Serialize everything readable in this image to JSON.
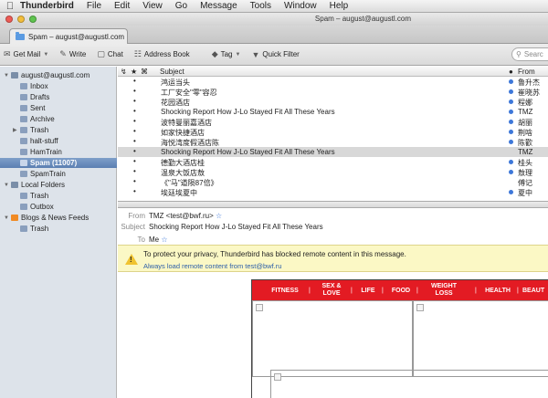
{
  "menubar": {
    "app": "Thunderbird",
    "items": [
      "File",
      "Edit",
      "View",
      "Go",
      "Message",
      "Tools",
      "Window",
      "Help"
    ]
  },
  "window": {
    "title": "Spam – august@augustl.com"
  },
  "tab": {
    "label": "Spam – august@augustl.com"
  },
  "toolbar": {
    "get_mail": "Get Mail",
    "write": "Write",
    "chat": "Chat",
    "address_book": "Address Book",
    "tag": "Tag",
    "quick_filter": "Quick Filter",
    "search_placeholder": "Searc"
  },
  "folders": [
    {
      "label": "august@augustl.com",
      "level": 0,
      "twisty": "▼",
      "icon": "account-icon",
      "color": "#7a8ea8"
    },
    {
      "label": "Inbox",
      "level": 1,
      "icon": "inbox-icon",
      "color": "#8a9fbd"
    },
    {
      "label": "Drafts",
      "level": 1,
      "icon": "drafts-icon",
      "color": "#8a9fbd"
    },
    {
      "label": "Sent",
      "level": 1,
      "icon": "sent-icon",
      "color": "#8a9fbd"
    },
    {
      "label": "Archive",
      "level": 1,
      "icon": "archive-icon",
      "color": "#8a9fbd"
    },
    {
      "label": "Trash",
      "level": 1,
      "twisty": "▶",
      "icon": "trash-icon",
      "color": "#8a9fbd"
    },
    {
      "label": "halt-stuff",
      "level": 1,
      "icon": "folder-icon",
      "color": "#8a9fbd"
    },
    {
      "label": "HamTrain",
      "level": 1,
      "icon": "folder-icon",
      "color": "#8a9fbd"
    },
    {
      "label": "Spam (11007)",
      "level": 1,
      "icon": "junk-icon",
      "color": "#c9d6ea",
      "selected": true
    },
    {
      "label": "SpamTrain",
      "level": 1,
      "icon": "folder-icon",
      "color": "#8a9fbd"
    },
    {
      "label": "Local Folders",
      "level": 0,
      "twisty": "▼",
      "icon": "local-folders-icon",
      "color": "#7a8ea8"
    },
    {
      "label": "Trash",
      "level": 1,
      "icon": "trash-icon",
      "color": "#8a9fbd"
    },
    {
      "label": "Outbox",
      "level": 1,
      "icon": "outbox-icon",
      "color": "#8a9fbd"
    },
    {
      "label": "Blogs & News Feeds",
      "level": 0,
      "twisty": "▼",
      "icon": "rss-icon",
      "color": "#f08a24"
    },
    {
      "label": "Trash",
      "level": 1,
      "icon": "trash-icon",
      "color": "#8a9fbd"
    }
  ],
  "list": {
    "columns": {
      "subject": "Subject",
      "from": "From"
    },
    "rows": [
      {
        "subject": "鸿运当头",
        "from": "鲁升杰",
        "unread": true
      },
      {
        "subject": "工厂安全\"零\"容忍",
        "from": "崔晓苏",
        "unread": true
      },
      {
        "subject": "花园酒店",
        "from": "程娜",
        "unread": true
      },
      {
        "subject": "Shocking Report How J-Lo Stayed Fit All These Years",
        "from": "TMZ",
        "unread": true
      },
      {
        "subject": "波特曼丽嘉酒店",
        "from": "胡丽",
        "unread": true
      },
      {
        "subject": "如家快捷酒店",
        "from": "荆啥",
        "unread": true
      },
      {
        "subject": "海悦湾度假酒店陈",
        "from": "陈歡",
        "unread": true
      },
      {
        "subject": "Shocking Report How J-Lo Stayed Fit All These Years",
        "from": "TMZ",
        "unread": false,
        "selected": true
      },
      {
        "subject": "德勤大酒店桂",
        "from": "桂头",
        "unread": true
      },
      {
        "subject": "温泉大饭店敖",
        "from": "敖理",
        "unread": true
      },
      {
        "subject": "《\"马\"道陨87倍》",
        "from": "傅记",
        "unread": false
      },
      {
        "subject": "埃廷埃夏中",
        "from": "夏中",
        "unread": true
      }
    ]
  },
  "header": {
    "from_label": "From",
    "from_value": "TMZ <test@bwf.ru>",
    "subject_label": "Subject",
    "subject_value": "Shocking Report How J-Lo Stayed Fit All These Years",
    "to_label": "To",
    "to_value": "Me"
  },
  "notice": {
    "text": "To protect your privacy, Thunderbird has blocked remote content in this message.",
    "link": "Always load remote content from test@bwf.ru"
  },
  "email_nav": [
    "FITNESS",
    "SEX & LOVE",
    "LIFE",
    "FOOD",
    "WEIGHT LOSS",
    "HEALTH",
    "BEAUT"
  ]
}
